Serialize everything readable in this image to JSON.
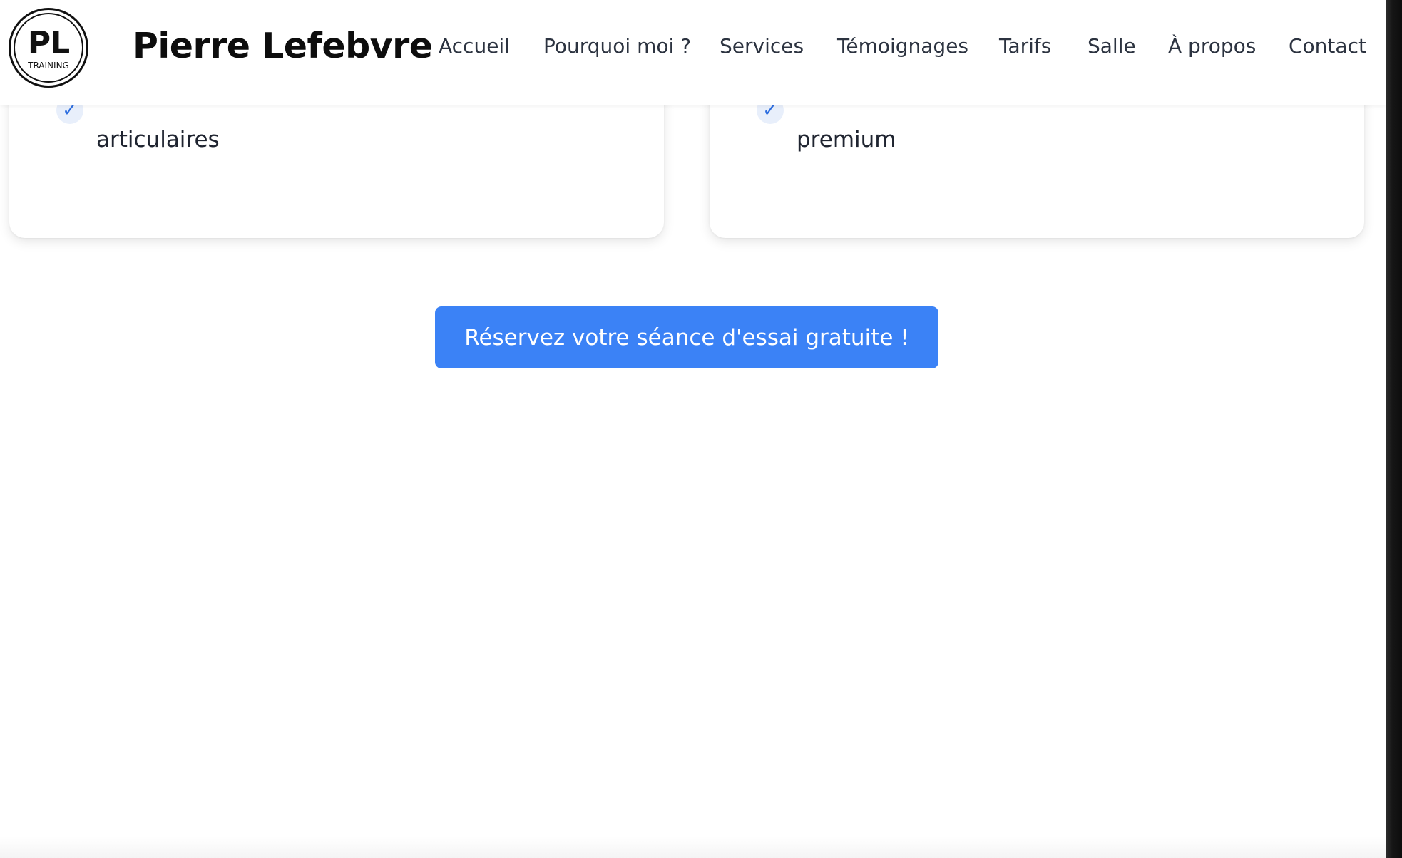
{
  "header": {
    "logo": {
      "mark": "PL",
      "subtitle": "TRAINING"
    },
    "brand_name": "Pierre Lefebvre",
    "nav": [
      {
        "label": "Accueil"
      },
      {
        "label": "Pourquoi moi ?"
      },
      {
        "label": "Services"
      },
      {
        "label": "Témoignages"
      },
      {
        "label": "Tarifs"
      },
      {
        "label": "Salle"
      },
      {
        "label": "À propos"
      },
      {
        "label": "Contact"
      }
    ]
  },
  "cards": [
    {
      "feature_last_line": "articulaires"
    },
    {
      "feature_last_line": "premium"
    }
  ],
  "cta": {
    "label": "Réservez votre séance d'essai gratuite !"
  },
  "colors": {
    "accent": "#3b82f6",
    "check": "#2f6fe0",
    "check_bg": "#e8effb",
    "text": "#1f2430",
    "nav_text": "#2c3340"
  },
  "icons": {
    "check": "check-icon"
  }
}
